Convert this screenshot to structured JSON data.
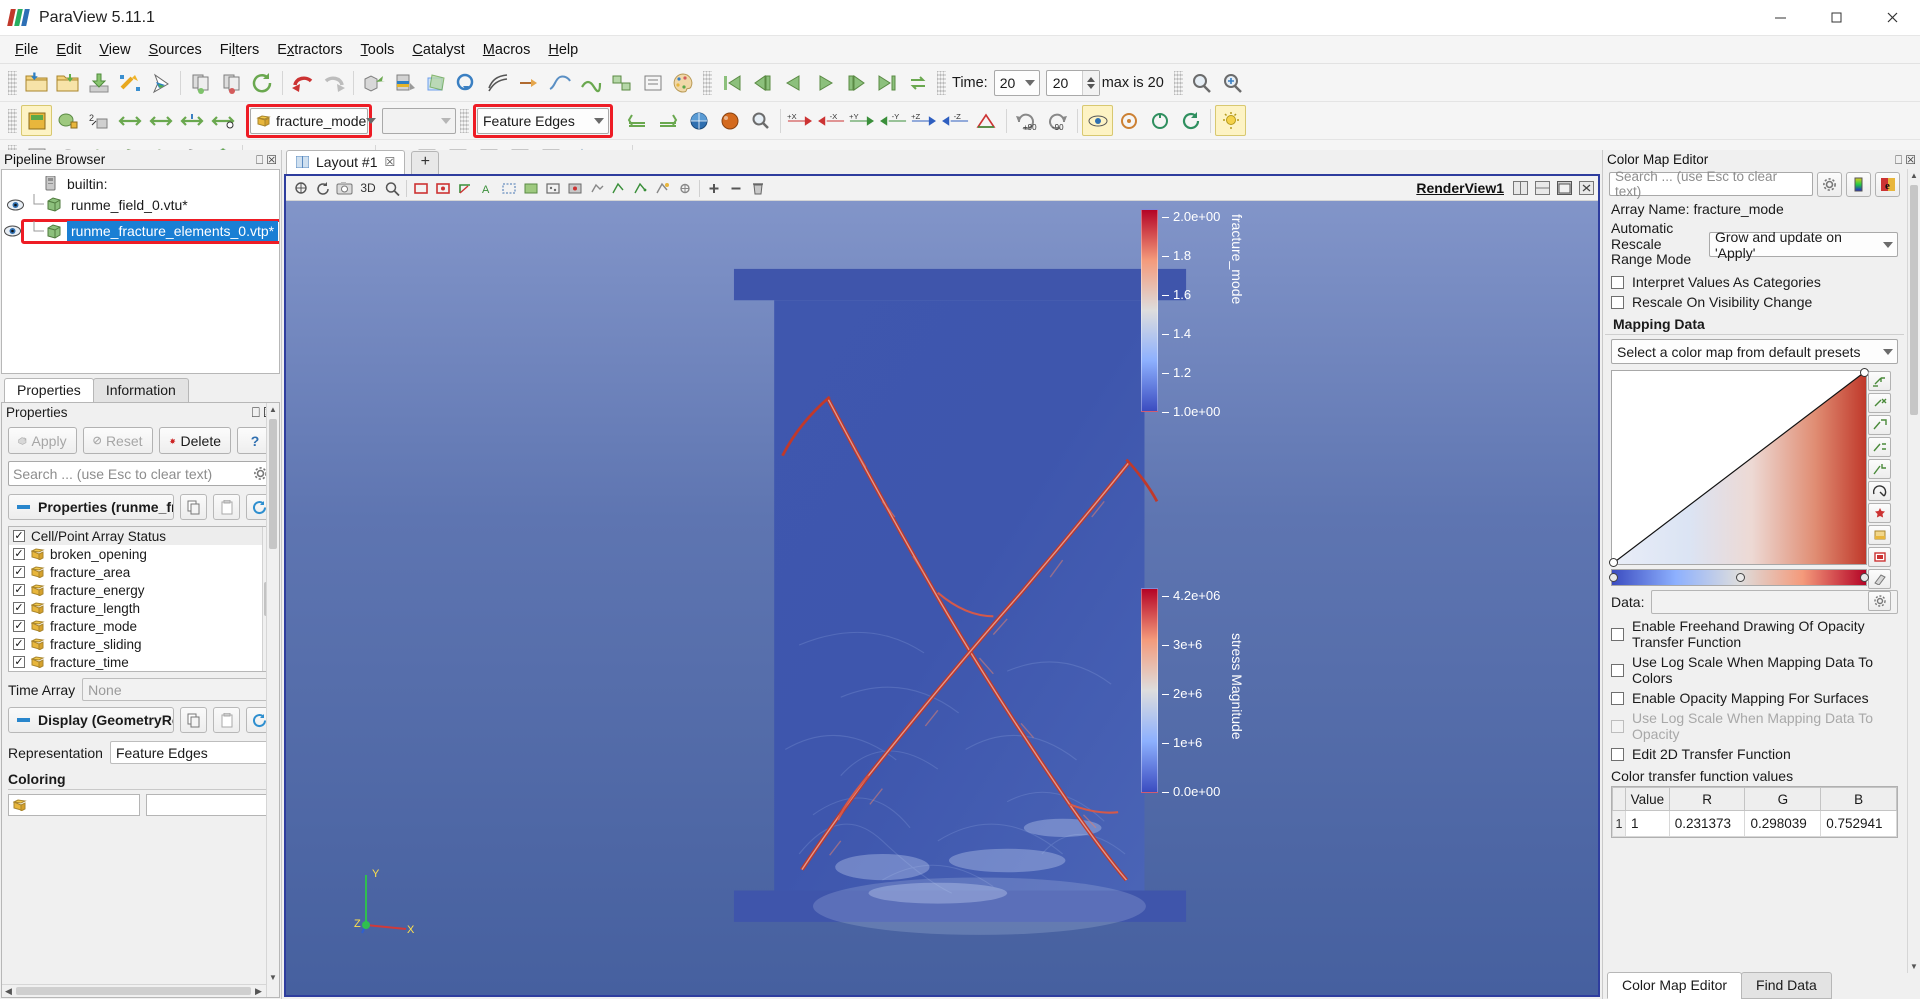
{
  "app": {
    "title": "ParaView 5.11.1",
    "logo_colors": [
      "#c0392b",
      "#27ae60",
      "#2d6fb5"
    ],
    "window_buttons": [
      "minimize",
      "maximize",
      "close"
    ]
  },
  "menubar": {
    "items": [
      {
        "label": "File",
        "mnemonic": "F"
      },
      {
        "label": "Edit",
        "mnemonic": "E"
      },
      {
        "label": "View",
        "mnemonic": "V"
      },
      {
        "label": "Sources",
        "mnemonic": "S"
      },
      {
        "label": "Filters",
        "mnemonic": "l"
      },
      {
        "label": "Extractors",
        "mnemonic": "x"
      },
      {
        "label": "Tools",
        "mnemonic": "T"
      },
      {
        "label": "Catalyst",
        "mnemonic": "C"
      },
      {
        "label": "Macros",
        "mnemonic": "M"
      },
      {
        "label": "Help",
        "mnemonic": "H"
      }
    ]
  },
  "toolbar_main": {
    "icons": [
      "open-file-icon",
      "open-recent-icon",
      "save-data-icon",
      "save-screenshot-icon",
      "save-state-icon",
      "connect-server-icon",
      "disconnect-server-icon",
      "reset-session-icon",
      "undo-icon",
      "redo-icon",
      "undo-camera-icon",
      "redo-camera-icon",
      "clip-icon",
      "slice-icon",
      "threshold-icon",
      "extract-subset-icon",
      "contour-icon",
      "glyph-icon",
      "stream-tracer-icon",
      "warp-icon",
      "group-icon",
      "extract-level-icon",
      "calculator-icon",
      "color-palette-icon"
    ],
    "vcr": [
      "first-frame-icon",
      "previous-frame-icon",
      "play-reverse-icon",
      "play-icon",
      "next-frame-icon",
      "last-frame-icon",
      "loop-icon"
    ],
    "time_label": "Time:",
    "time_value": "20",
    "frame_value": "20",
    "max_label": "max is 20",
    "right_icons": [
      "zoom-to-box-icon",
      "zoom-to-data-icon"
    ]
  },
  "toolbar_repr": {
    "left_icons": [
      "active-variables-icon",
      "solid-color-icon",
      "rescale-custom-icon",
      "rescale-data-range-icon",
      "rescale-visible-range-icon",
      "rescale-temporal-range-icon",
      "rescale-custom-range-icon"
    ],
    "coloring_array": "fracture_mode",
    "coloring_array_highlighted": true,
    "component_value": "",
    "representation": "Feature Edges",
    "representation_highlighted": true,
    "right_icons": [
      "edit-color-map-icon",
      "rescale-to-data-icon",
      "color-legend-icon",
      "sphere-preset-icon",
      "magnify-icon",
      "plus-x-icon",
      "minus-x-icon",
      "plus-y-icon",
      "minus-y-icon",
      "plus-z-icon",
      "minus-z-icon",
      "reset-camera-icon",
      "rotate-plus-90-icon",
      "rotate-minus-90-icon",
      "center-axes-icon",
      "pick-center-icon",
      "reset-center-icon",
      "rotation-center-icon",
      "light-kit-icon"
    ]
  },
  "toolbar_filters": {
    "icons": [
      "spreadsheet-icon",
      "tube-icon",
      "box-icon",
      "outline-icon",
      "wireframe-icon",
      "sphere-source-icon",
      "cylinder-icon",
      "cone-icon",
      "arrow-icon",
      "line-icon",
      "plot-over-line-icon",
      "plot-selection-icon",
      "bar-chart-icon",
      "histogram-icon",
      "quartile-chart-icon",
      "scatter-plot-icon",
      "python-calculator-icon",
      "programmable-filter-icon",
      "ruler-icon"
    ]
  },
  "pipeline": {
    "panel_title": "Pipeline Browser",
    "items": [
      {
        "label": "builtin:",
        "icon": "server-icon",
        "visible": false,
        "depth": 0,
        "selected": false
      },
      {
        "label": "runme_field_0.vtu*",
        "icon": "mesh-icon",
        "visible": true,
        "depth": 1,
        "selected": false
      },
      {
        "label": "runme_fracture_elements_0.vtp*",
        "icon": "mesh-icon",
        "visible": true,
        "depth": 1,
        "selected": true,
        "highlighted": true
      }
    ]
  },
  "properties_panel": {
    "tabs": [
      {
        "label": "Properties",
        "active": true
      },
      {
        "label": "Information",
        "active": false
      }
    ],
    "panel_title": "Properties",
    "buttons": [
      {
        "label": "Apply",
        "icon": "apply-icon",
        "enabled": false
      },
      {
        "label": "Reset",
        "icon": "reset-icon",
        "enabled": false
      },
      {
        "label": "Delete",
        "icon": "delete-icon",
        "enabled": true
      },
      {
        "label": "?",
        "icon": "help-icon",
        "enabled": true
      }
    ],
    "search_placeholder": "Search ... (use Esc to clear text)",
    "section_title": "Properties (runme_fra",
    "section_icons": [
      "copy-icon",
      "paste-icon",
      "restore-defaults-icon"
    ],
    "array_status_header": "Cell/Point Array Status",
    "arrays": [
      {
        "label": "broken_opening",
        "checked": true
      },
      {
        "label": "fracture_area",
        "checked": true
      },
      {
        "label": "fracture_energy",
        "checked": true
      },
      {
        "label": "fracture_length",
        "checked": true
      },
      {
        "label": "fracture_mode",
        "checked": true
      },
      {
        "label": "fracture_sliding",
        "checked": true
      },
      {
        "label": "fracture_time",
        "checked": true
      }
    ],
    "time_array_label": "Time Array",
    "time_array_value": "None",
    "display_section_title": "Display (GeometryRep",
    "display_icons": [
      "copy-icon",
      "paste-icon",
      "restore-defaults-icon"
    ],
    "representation_label": "Representation",
    "representation_value": "Feature Edges",
    "coloring_label": "Coloring"
  },
  "layout": {
    "tabs": [
      {
        "label": "Layout #1",
        "active": true,
        "closable": true
      }
    ],
    "add_tab_label": "+"
  },
  "render_view": {
    "name": "RenderView1",
    "toolbar_icons": [
      "interaction-mode-icon",
      "camera-undo-icon",
      "camera-screenshot-icon",
      "mode-3d-label",
      "zoom-area-icon",
      "axes-visibility-icon",
      "center-axes-icon",
      "orientation-axes-icon",
      "show-labels-icon",
      "select-cells-icon",
      "select-points-icon",
      "select-cells-through-icon",
      "select-points-through-icon",
      "select-block-icon",
      "frustum-select-icon",
      "select-polygon-icon",
      "hover-cells-icon",
      "hover-points-icon",
      "interactive-select-icon",
      "grow-selection-icon",
      "shrink-selection-icon",
      "clear-selection-icon"
    ],
    "split_icons": [
      "split-horizontal-icon",
      "split-vertical-icon",
      "maximize-icon",
      "close-view-icon"
    ],
    "mode_3d_label": "3D",
    "axes": {
      "x": "X",
      "y": "Y",
      "z": "Z"
    },
    "legends": [
      {
        "title": "fracture_mode",
        "ticks": [
          "2.0e+00",
          "1.8",
          "1.6",
          "1.4",
          "1.2",
          "1.0e+00"
        ],
        "min_color": "#3b4cc0",
        "max_color": "#b40426"
      },
      {
        "title": "stress Magnitude",
        "ticks": [
          "4.2e+06",
          "3e+6",
          "2e+6",
          "1e+6",
          "0.0e+00"
        ],
        "min_color": "#3b4cc0",
        "max_color": "#b40426"
      }
    ]
  },
  "color_map_editor": {
    "panel_title": "Color Map Editor",
    "search_placeholder": "Search ... (use Esc to clear text)",
    "header_icons": [
      "gear-icon",
      "color-legend-icon",
      "edit-color-icon"
    ],
    "array_name_label": "Array Name: fracture_mode",
    "rescale_mode_label": "Automatic Rescale Range Mode",
    "rescale_mode_value": "Grow and update on 'Apply'",
    "checkboxes_top": [
      {
        "label": "Interpret Values As Categories",
        "checked": false,
        "enabled": true
      },
      {
        "label": "Rescale On Visibility Change",
        "checked": false,
        "enabled": true
      }
    ],
    "mapping_data_label": "Mapping Data",
    "preset_select_value": "Select a color map from default presets",
    "side_buttons": [
      "add-point-icon",
      "remove-point-icon",
      "remove-all-points-icon",
      "invert-icon",
      "rescale-icon",
      "choose-preset-icon",
      "save-preset-icon",
      "nan-color-icon",
      "advanced-icon",
      "gear-icon"
    ],
    "data_label": "Data:",
    "data_value": "",
    "checkboxes_bottom": [
      {
        "label": "Enable Freehand Drawing Of Opacity Transfer Function",
        "checked": false,
        "enabled": true
      },
      {
        "label": "Use Log Scale When Mapping Data To Colors",
        "checked": false,
        "enabled": true
      },
      {
        "label": "Enable Opacity Mapping For Surfaces",
        "checked": false,
        "enabled": true
      },
      {
        "label": "Use Log Scale When Mapping Data To Opacity",
        "checked": false,
        "enabled": false
      },
      {
        "label": "Edit 2D Transfer Function",
        "checked": false,
        "enabled": true
      }
    ],
    "ctf_label": "Color transfer function values",
    "ctf_columns": [
      "",
      "Value",
      "R",
      "G",
      "B"
    ],
    "ctf_rows": [
      {
        "index": "1",
        "value": "1",
        "r": "0.231373",
        "g": "0.298039",
        "b": "0.752941"
      }
    ],
    "bottom_tabs": [
      {
        "label": "Color Map Editor",
        "active": true
      },
      {
        "label": "Find Data",
        "active": false
      }
    ]
  },
  "colors": {
    "accent_blue": "#1a7fd4",
    "highlight_red": "#ee1c25",
    "view_border": "#2e3d9e",
    "cold": "#3b4cc0",
    "hot": "#b40426",
    "panel_bg": "#f0f0f0"
  }
}
